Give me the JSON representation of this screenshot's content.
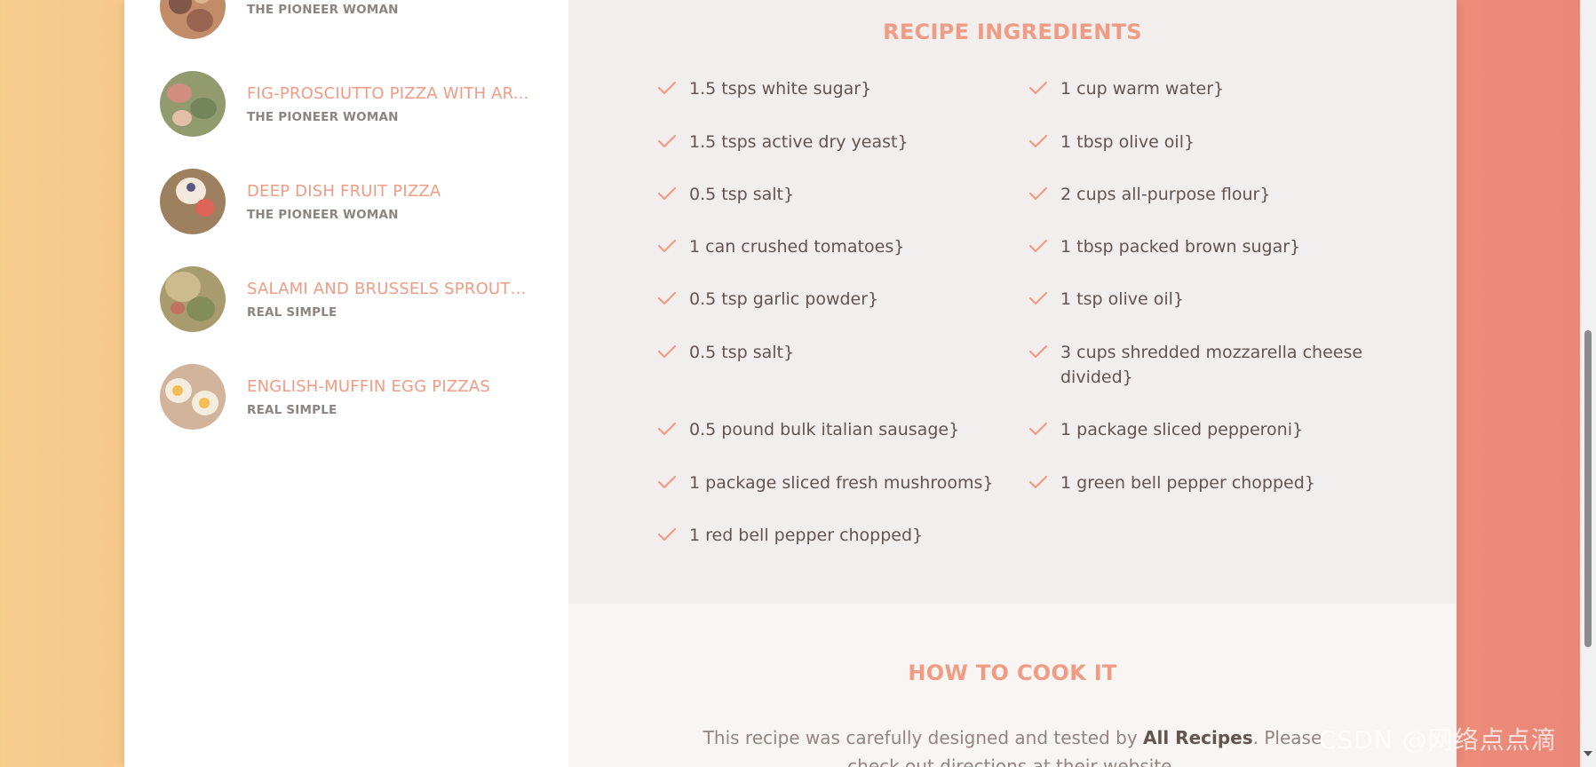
{
  "sidebar": {
    "results": [
      {
        "title": "",
        "publisher": "THE PIONEER WOMAN"
      },
      {
        "title": "FIG-PROSCIUTTO PIZZA WITH AR...",
        "publisher": "THE PIONEER WOMAN"
      },
      {
        "title": "DEEP DISH FRUIT PIZZA",
        "publisher": "THE PIONEER WOMAN"
      },
      {
        "title": "SALAMI AND BRUSSELS SPROUTS...",
        "publisher": "REAL SIMPLE"
      },
      {
        "title": "ENGLISH-MUFFIN EGG PIZZAS",
        "publisher": "REAL SIMPLE"
      }
    ]
  },
  "ingredients": {
    "title": "RECIPE INGREDIENTS",
    "items": [
      "1.5 tsps white sugar}",
      "1 cup warm water}",
      "1.5 tsps active dry yeast}",
      "1 tbsp olive oil}",
      "0.5 tsp salt}",
      "2 cups all-purpose flour}",
      "1 can crushed tomatoes}",
      "1 tbsp packed brown sugar}",
      "0.5 tsp garlic powder}",
      "1 tsp olive oil}",
      "0.5 tsp salt}",
      "3 cups shredded mozzarella cheese divided}",
      "0.5 pound bulk italian sausage}",
      "1 package sliced pepperoni}",
      "1 package sliced fresh mushrooms}",
      "1 green bell pepper chopped}",
      "1 red bell pepper chopped}"
    ]
  },
  "how_to_cook": {
    "title": "HOW TO COOK IT",
    "text_before": "This recipe was carefully designed and tested by ",
    "publisher": "All Recipes",
    "text_after": ". Please check out directions at their website."
  },
  "watermark": "CSDN @网络点点滴",
  "colors": {
    "accent": "#f09c85",
    "text": "#615551",
    "ingredients_bg": "#f2eeed",
    "how_bg": "#f9f5f3"
  },
  "icons": {
    "ingredient_marker": "check-icon"
  }
}
